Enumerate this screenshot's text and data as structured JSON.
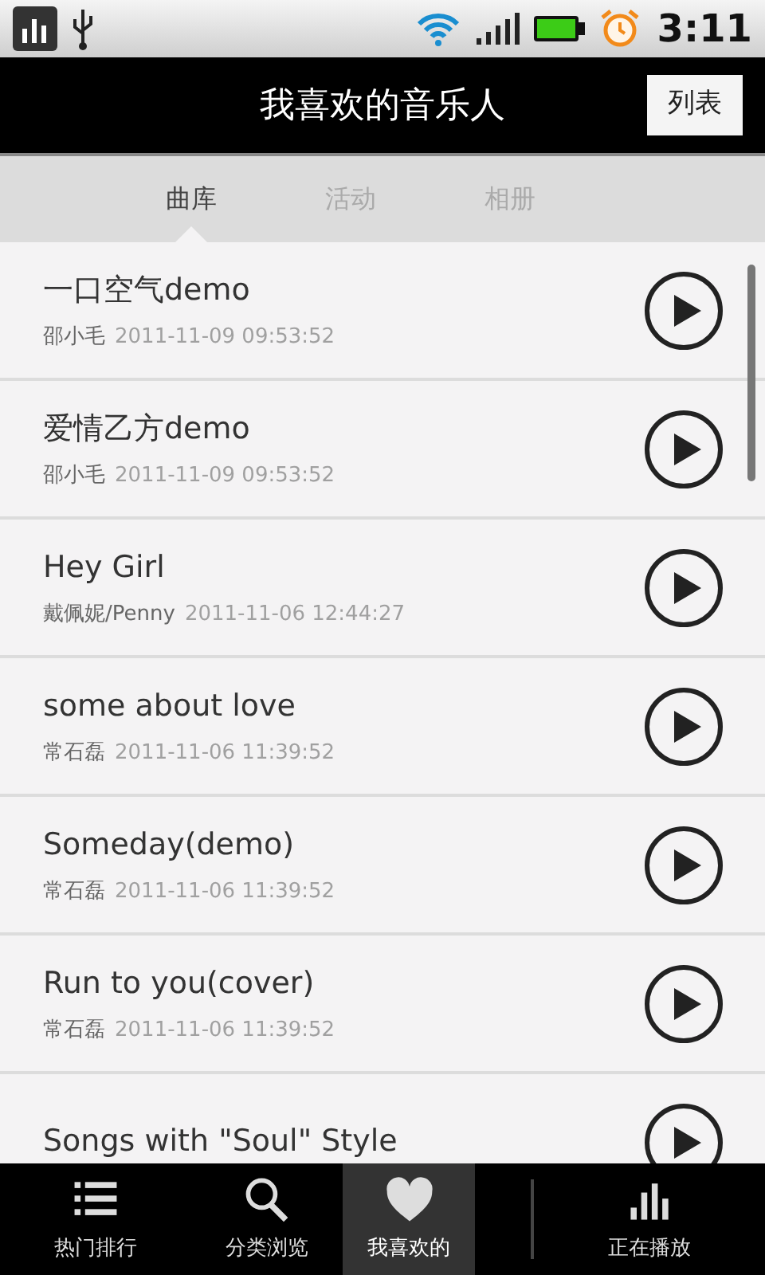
{
  "status_bar": {
    "time": "3:11"
  },
  "title_bar": {
    "title": "我喜欢的音乐人",
    "button": "列表"
  },
  "tabs": [
    {
      "label": "曲库",
      "selected": true
    },
    {
      "label": "活动",
      "selected": false
    },
    {
      "label": "相册",
      "selected": false
    }
  ],
  "songs": [
    {
      "title": "一口空气demo",
      "artist": "邵小毛",
      "date": "2011-11-09 09:53:52"
    },
    {
      "title": "爱情乙方demo",
      "artist": "邵小毛",
      "date": "2011-11-09 09:53:52"
    },
    {
      "title": "Hey Girl",
      "artist": "戴佩妮/Penny",
      "date": "2011-11-06 12:44:27"
    },
    {
      "title": "some about love",
      "artist": "常石磊",
      "date": "2011-11-06 11:39:52"
    },
    {
      "title": "Someday(demo)",
      "artist": "常石磊",
      "date": "2011-11-06 11:39:52"
    },
    {
      "title": "Run to you(cover)",
      "artist": "常石磊",
      "date": "2011-11-06 11:39:52"
    },
    {
      "title": "Songs with \"Soul\" Style"
    }
  ],
  "bottom_nav": [
    {
      "label": "热门排行",
      "selected": false
    },
    {
      "label": "分类浏览",
      "selected": false
    },
    {
      "label": "我喜欢的",
      "selected": true
    },
    {
      "label": "正在播放",
      "selected": false
    }
  ]
}
